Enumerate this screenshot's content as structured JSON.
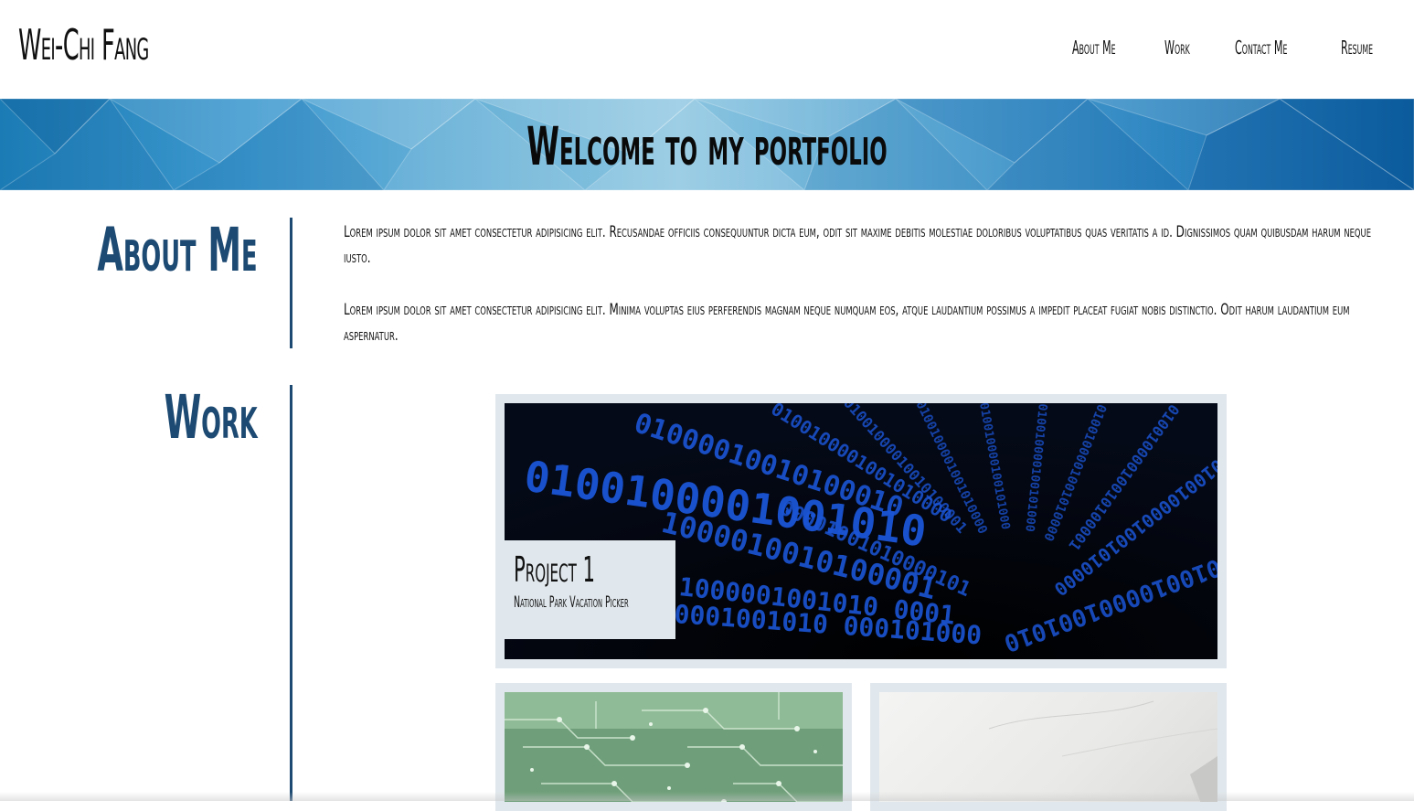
{
  "header": {
    "brand": "Wei-Chi Fang",
    "nav": [
      {
        "label": "About Me"
      },
      {
        "label": "Work"
      },
      {
        "label": "Contact Me"
      },
      {
        "label": "Resume"
      }
    ]
  },
  "banner": {
    "title": "Welcome to my portfolio"
  },
  "about": {
    "heading": "About Me",
    "paragraphs": [
      "Lorem ipsum dolor sit amet consectetur adipisicing elit. Recusandae officiis consequuntur dicta eum, odit sit maxime debitis molestiae doloribus voluptatibus quas veritatis a id. Dignissimos quam quibusdam harum neque iusto.",
      "Lorem ipsum dolor sit amet consectetur adipisicing elit. Minima voluptas eius perferendis magnam neque numquam eos, atque laudantium possimus a impedit placeat fugiat nobis distinctio. Odit harum laudantium eum aspernatur."
    ]
  },
  "work": {
    "heading": "Work",
    "projects": [
      {
        "title": "Project 1",
        "subtitle": "National Park Vacation Picker",
        "image": "binary-code-image"
      },
      {
        "image": "circuit-board-image"
      },
      {
        "image": "white-desk-image"
      }
    ]
  },
  "colors": {
    "accent": "#1d4a72",
    "card_bg": "#e1e8ed",
    "banner_blue": "#3f9ad0"
  }
}
